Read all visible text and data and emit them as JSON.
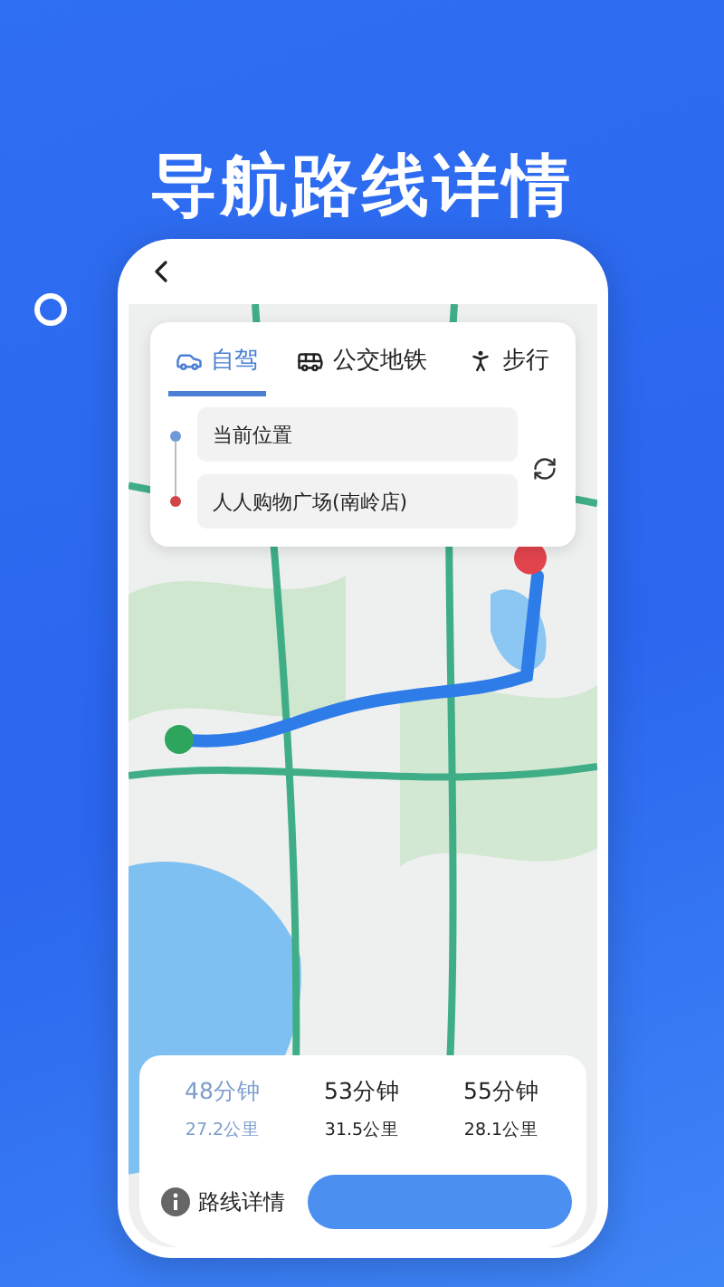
{
  "headline": "导航路线详情",
  "modes": [
    {
      "kind": "car",
      "label": "自驾",
      "selected": true
    },
    {
      "kind": "bus",
      "label": "公交地铁",
      "selected": false
    },
    {
      "kind": "walk",
      "label": "步行",
      "selected": false
    }
  ],
  "origin": "当前位置",
  "destination": "人人购物广场(南岭店)",
  "routes": [
    {
      "time": "48分钟",
      "distance": "27.2公里",
      "selected": true
    },
    {
      "time": "53分钟",
      "distance": "31.5公里",
      "selected": false
    },
    {
      "time": "55分钟",
      "distance": "28.1公里",
      "selected": false
    }
  ],
  "details_link": "路线详情"
}
